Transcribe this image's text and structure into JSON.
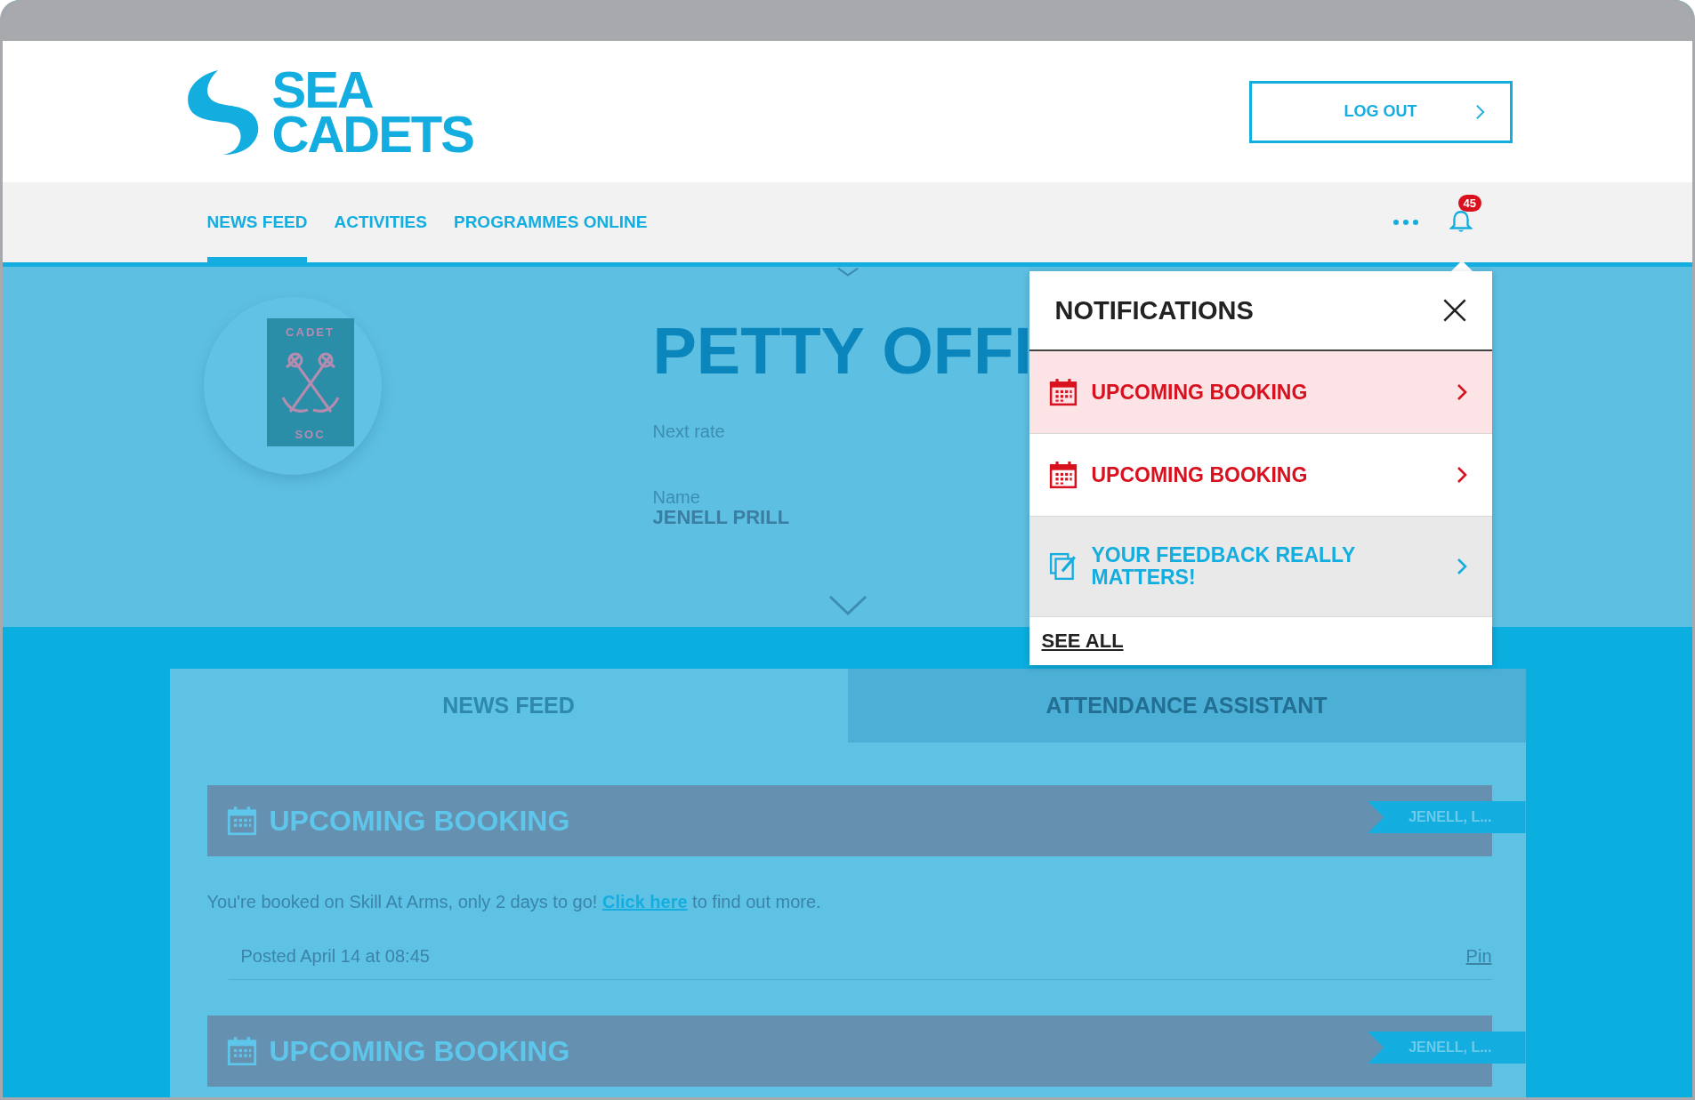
{
  "header": {
    "logo": {
      "line_1": "SEA",
      "line_2": "CADETS"
    },
    "logout_button": "LOG OUT"
  },
  "nav": {
    "items": [
      {
        "label": "NEWS FEED",
        "selected": true
      },
      {
        "label": "ACTIVITIES",
        "selected": false
      },
      {
        "label": "PROGRAMMES ONLINE",
        "selected": false
      }
    ],
    "notification_count": "45"
  },
  "profile": {
    "badge": {
      "top": "CADET",
      "bottom": "SOC"
    },
    "rank": "PETTY OFFI",
    "next_rate_label": "Next rate",
    "name_label": "Name",
    "name": "JENELL PRILL"
  },
  "notifications": {
    "title": "NOTIFICATIONS",
    "items": [
      {
        "kind": "booking",
        "title": "UPCOMING BOOKING",
        "highlighted": true,
        "read": false
      },
      {
        "kind": "booking",
        "title": "UPCOMING BOOKING",
        "highlighted": false,
        "read": false
      },
      {
        "kind": "feedback",
        "title": "YOUR FEEDBACK REALLY MATTERS!",
        "highlighted": false,
        "read": true
      }
    ],
    "see_all": "SEE ALL"
  },
  "feed": {
    "tabs": [
      {
        "label": "NEWS FEED",
        "selected": true
      },
      {
        "label": "ATTENDANCE ASSISTANT",
        "selected": false
      }
    ],
    "posts": [
      {
        "title": "UPCOMING BOOKING",
        "author": "JENELL, L...",
        "text_before": "You're booked on Skill At Arms, only 2 days to go!",
        "link": "Click here",
        "text_after": "to find out more.",
        "posted": "Posted April 14 at 08:45",
        "pin": "Pin"
      },
      {
        "title": "UPCOMING BOOKING",
        "author": "JENELL, L..."
      }
    ]
  }
}
